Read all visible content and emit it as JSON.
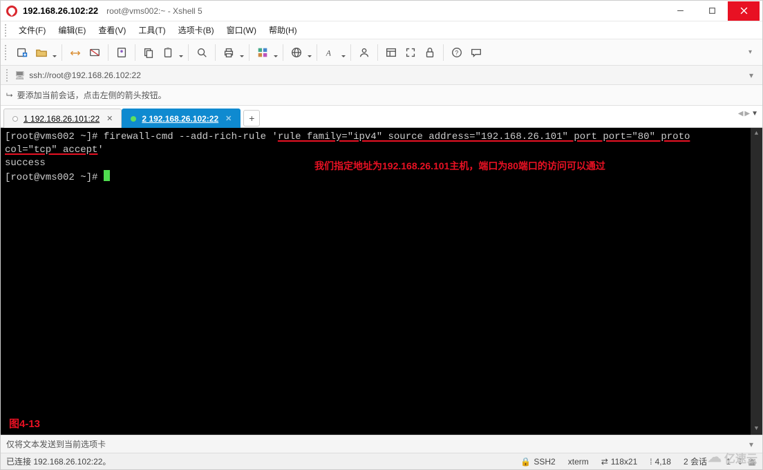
{
  "title": {
    "ip": "192.168.26.102:22",
    "app": "root@vms002:~ - Xshell 5"
  },
  "menu": {
    "file": "文件(F)",
    "edit": "编辑(E)",
    "view": "查看(V)",
    "tools": "工具(T)",
    "tabs": "选项卡(B)",
    "window": "窗口(W)",
    "help": "帮助(H)"
  },
  "address_bar": {
    "url": "ssh://root@192.168.26.102:22"
  },
  "info_bar": {
    "hint": "要添加当前会话，点击左侧的箭头按钮。"
  },
  "tabs": {
    "t1": {
      "num": "1",
      "label": "192.168.26.101:22"
    },
    "t2": {
      "num": "2",
      "label": "192.168.26.102:22"
    }
  },
  "terminal": {
    "prompt1_a": "[root@vms002 ~]# firewall-cmd --add-rich-rule '",
    "prompt1_b": "rule family=\"ipv4\" source address=\"192.168.26.101\" port port=\"80\" proto",
    "prompt1_c": "col=\"tcp\" accept",
    "prompt1_d": "'",
    "out1": "success",
    "prompt2": "[root@vms002 ~]# ",
    "annotation": "我们指定地址为192.168.26.101主机，端口为80端口的访问可以通过",
    "figure": "图4-13"
  },
  "footer": {
    "send_hint": "仅将文本发送到当前选项卡"
  },
  "status": {
    "connected": "已连接 192.168.26.102:22。",
    "ssh": "SSH2",
    "term": "xterm",
    "size": "118x21",
    "pos": "4,18",
    "sessions": "2 会话",
    "size_icon": "⇄",
    "pos_icon": "⁞",
    "lock_icon": "🔒"
  },
  "watermark": {
    "text": "亿速云"
  }
}
